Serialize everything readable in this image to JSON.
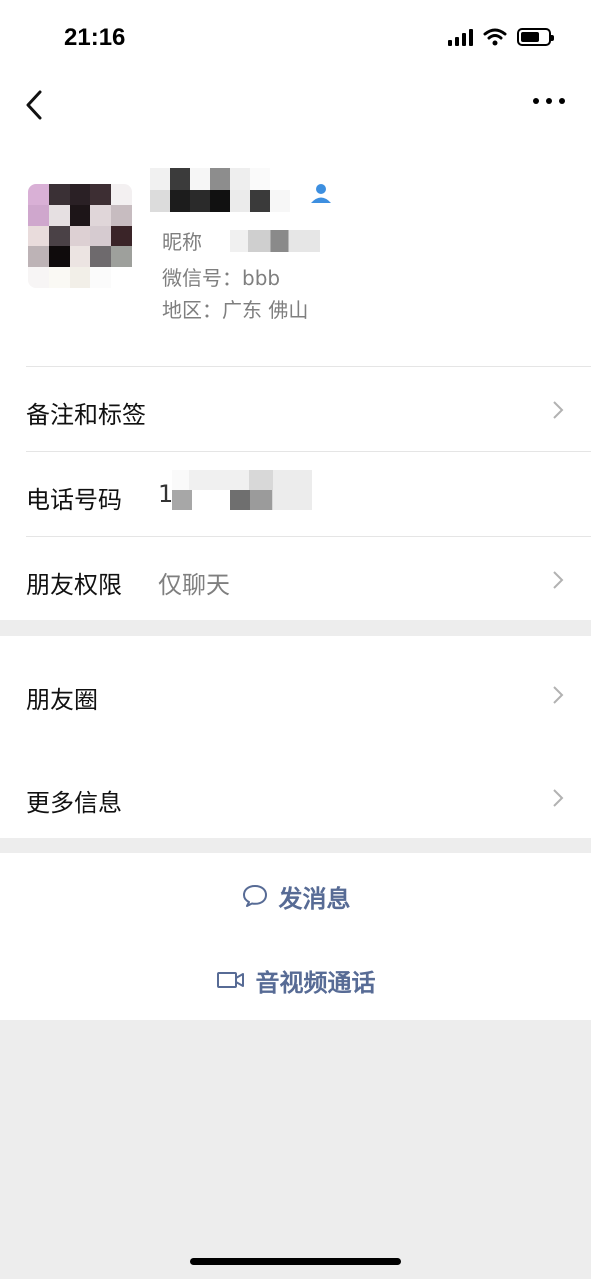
{
  "status_bar": {
    "time": "21:16"
  },
  "profile": {
    "nickname_label": "昵称",
    "wechat_id": "微信号：bbb",
    "region": "地区：广东 佛山"
  },
  "rows": {
    "remarks_tags": {
      "label": "备注和标签"
    },
    "phone": {
      "label": "电话号码",
      "value_prefix": "1"
    },
    "friend_permission": {
      "label": "朋友权限",
      "value": "仅聊天"
    },
    "moments": {
      "label": "朋友圈"
    },
    "more_info": {
      "label": "更多信息"
    }
  },
  "actions": {
    "send_message": "发消息",
    "video_call": "音视频通话"
  },
  "colors": {
    "link_blue": "#576b95",
    "secondary_gray": "#7f7f7f",
    "background": "#ededed"
  }
}
